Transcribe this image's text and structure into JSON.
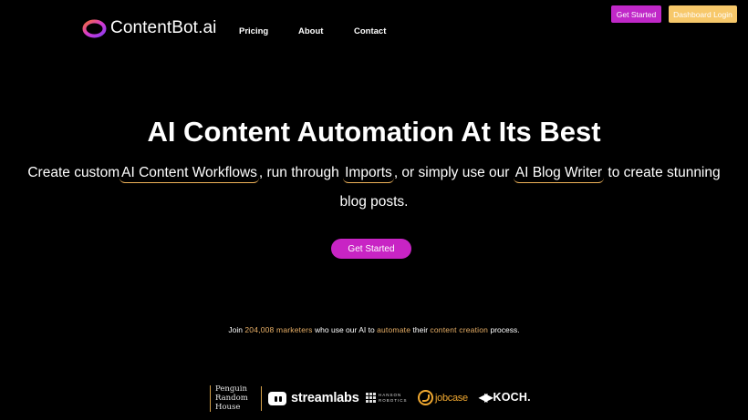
{
  "header": {
    "brand": "ContentBot.ai",
    "nav": [
      {
        "label": "Pricing"
      },
      {
        "label": "About"
      },
      {
        "label": "Contact"
      }
    ],
    "get_started_label": "Get Started",
    "dashboard_login_label": "Dashboard Login"
  },
  "hero": {
    "title": "AI Content Automation At Its Best",
    "line1_a": "Create custom",
    "link_workflows": "AI Content Workflows",
    "line1_b": ", run through",
    "link_imports": "Imports",
    "line1_c": ", or simply use our",
    "link_blog_writer": "AI Blog Writer",
    "line1_d": " to create stunning",
    "line2": "blog posts.",
    "cta_label": "Get Started"
  },
  "social_proof": {
    "prefix": "Join",
    "count": "204,008 marketers",
    "mid1": "who use our AI to",
    "automate": "automate",
    "mid2": "their",
    "content_creation": "content creation",
    "suffix": "process."
  },
  "logos": {
    "penguin_line1": "Penguin",
    "penguin_line2": "Random",
    "penguin_line3": "House",
    "streamlabs": "streamlabs",
    "hanson_line1": "HANSON",
    "hanson_line2": "ROBOTICS",
    "jobcase": "jobcase",
    "koch": "KOCH."
  },
  "colors": {
    "accent_magenta": "#c824c4",
    "accent_gold": "#f7c86a",
    "highlight_underline": "#f2b45a",
    "background": "#000000"
  }
}
